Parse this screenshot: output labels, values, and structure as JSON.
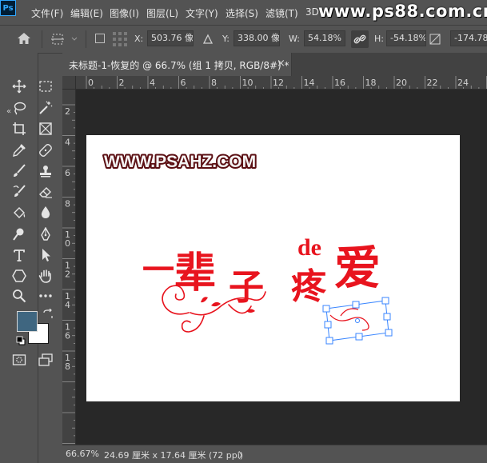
{
  "app": {
    "logo_text": "Ps"
  },
  "menu": [
    {
      "label": "文件(F)"
    },
    {
      "label": "编辑(E)"
    },
    {
      "label": "图像(I)"
    },
    {
      "label": "图层(L)"
    },
    {
      "label": "文字(Y)"
    },
    {
      "label": "选择(S)"
    },
    {
      "label": "滤镜(T)"
    },
    {
      "label": "3D"
    }
  ],
  "watermark": "www.ps88.com.cn",
  "options": {
    "x_label": "X:",
    "x_value": "503.76 像素",
    "y_label": "Y:",
    "y_value": "338.00 像素",
    "w_label": "W:",
    "w_value": "54.18%",
    "h_label": "H:",
    "h_value": "-54.18%",
    "rotate_value": "-174.78"
  },
  "document": {
    "tab_title": "未标题-1-恢复的 @ 66.7% (组 1 拷贝, RGB/8#) *",
    "close_glyph": "×",
    "collapse_glyph": "«"
  },
  "rulers": {
    "h_labels": [
      "0",
      "2",
      "4",
      "6",
      "8",
      "10",
      "12",
      "14",
      "16",
      "18",
      "20",
      "22",
      "24"
    ],
    "v_labels": [
      "2",
      "4",
      "6",
      "8",
      "10",
      "12",
      "14",
      "16",
      "18"
    ]
  },
  "canvas": {
    "logo_text": "WWW.PSAHZ.COM",
    "title_chars": [
      "一",
      "辈",
      "子",
      "疼",
      "爱"
    ],
    "de_text": "de",
    "text_color": "#e8141e"
  },
  "status": {
    "zoom": "66.67%",
    "doc_size": "24.69 厘米 x 17.64 厘米 (72 ppi)",
    "arrow": "〉"
  },
  "colors": {
    "foreground": "#3f6680",
    "background": "#ffffff",
    "ui_gray": "#535353"
  }
}
